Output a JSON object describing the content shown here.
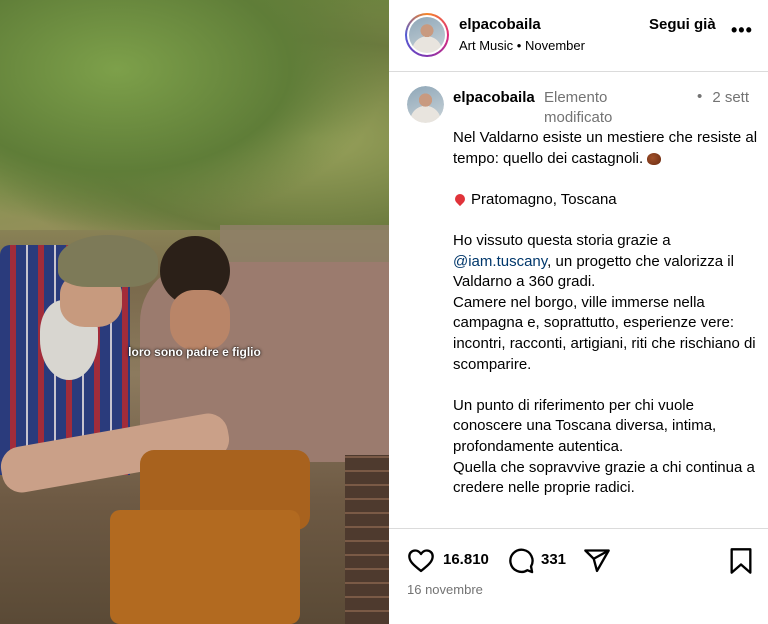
{
  "post": {
    "video_caption": "loro sono padre e figlio"
  },
  "header": {
    "username": "elpacobaila",
    "audio": "Art Music",
    "separator": "•",
    "month": "November",
    "follow_label": "Segui già",
    "more_label": "•••"
  },
  "comment": {
    "username": "elpacobaila",
    "edited_label": "Elemento modificato",
    "dot": "•",
    "time": "2 sett",
    "lines": {
      "l1": "Nel Valdarno esiste un mestiere che resiste al tempo: quello dei castagnoli.",
      "location": "Pratomagno, Toscana",
      "l3_pre": "Ho vissuto questa storia grazie a",
      "mention": "@iam.tuscany",
      "l3_post": ", un progetto che valorizza il Valdarno a 360 gradi.",
      "l4": "Camere nel borgo, ville immerse nella campagna e, soprattutto, esperienze vere: incontri, racconti, artigiani, riti che rischiano di scomparire.",
      "l5": "Un punto di riferimento per chi vuole conoscere una Toscana diversa, intima, profondamente autentica.",
      "l6": "Quella che sopravvive grazie a chi continua a credere nelle proprie radici."
    }
  },
  "actions": {
    "likes": "16.810",
    "comments": "331",
    "date": "16 novembre"
  },
  "colors": {
    "text": "#000000",
    "secondary": "#737373",
    "mention": "#00376b",
    "divider": "#dbdbdb"
  }
}
